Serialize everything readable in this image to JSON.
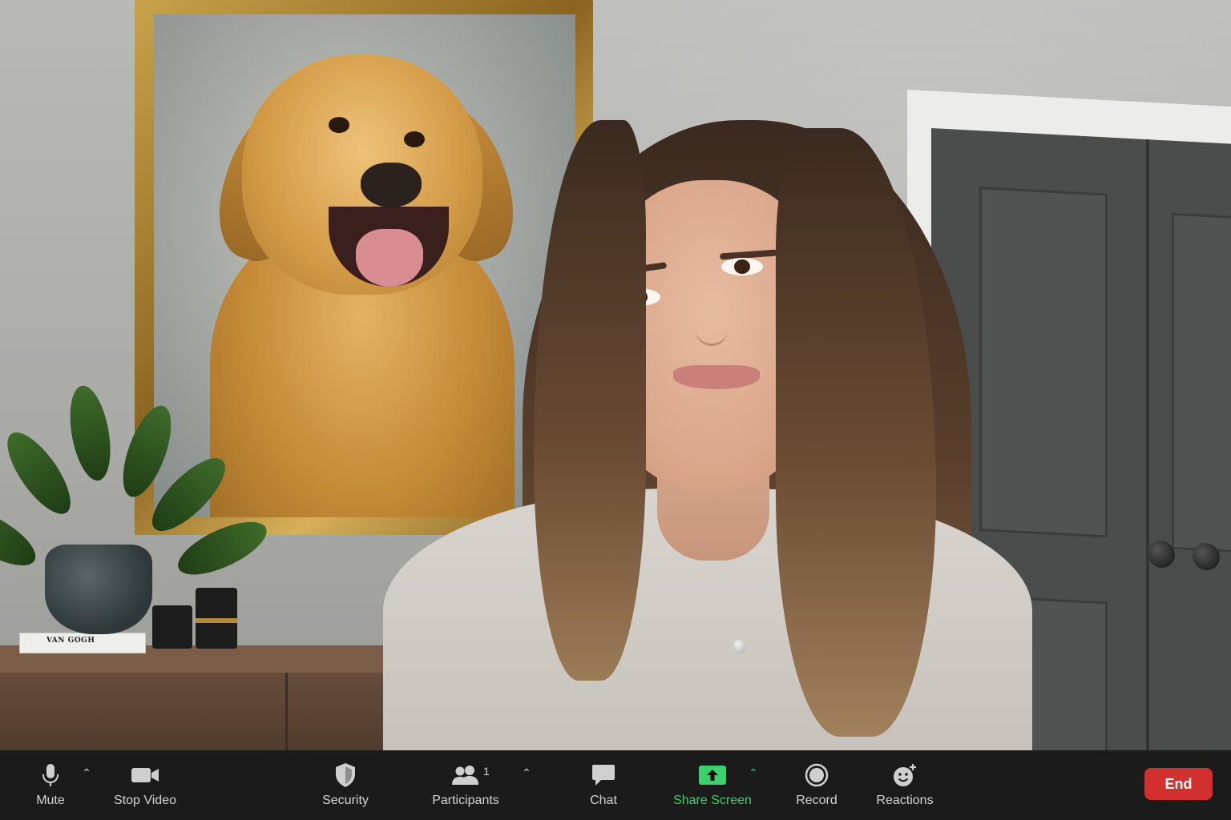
{
  "video": {
    "books_label": "VAN GOGH"
  },
  "toolbar": {
    "mute_label": "Mute",
    "stop_video_label": "Stop Video",
    "security_label": "Security",
    "participants_label": "Participants",
    "participants_count": "1",
    "chat_label": "Chat",
    "share_screen_label": "Share Screen",
    "record_label": "Record",
    "reactions_label": "Reactions",
    "end_label": "End",
    "caret_glyph": "⌃"
  },
  "icons": {
    "mute": "microphone-icon",
    "stop_video": "video-camera-icon",
    "security": "shield-icon",
    "participants": "participants-icon",
    "chat": "chat-bubble-icon",
    "share_screen": "share-screen-icon",
    "record": "record-icon",
    "reactions": "reactions-icon"
  },
  "colors": {
    "toolbar_bg": "#1b1b1b",
    "share_green": "#3bd16f",
    "end_red": "#d1302f",
    "label_gray": "#d4d4d4"
  }
}
